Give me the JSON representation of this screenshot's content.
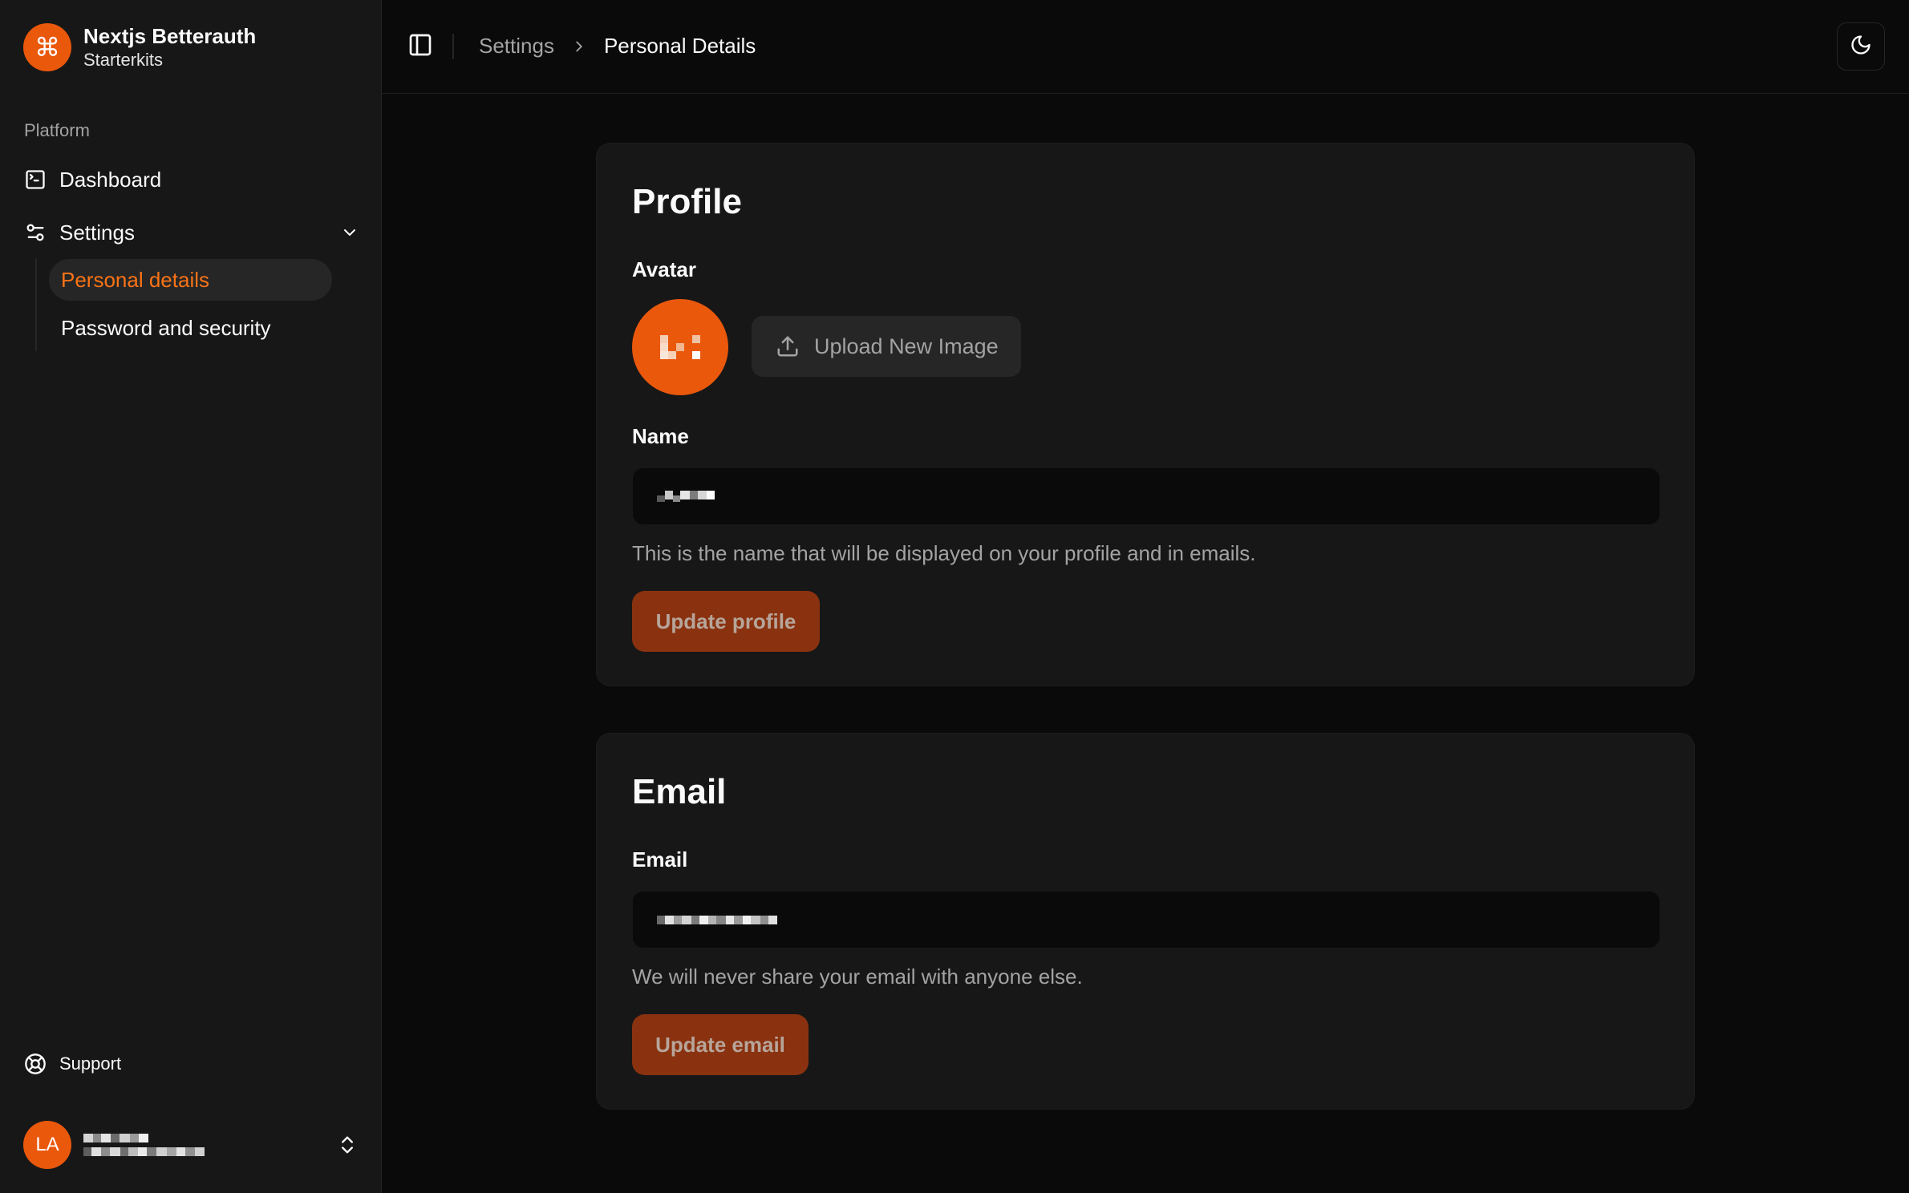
{
  "brand": {
    "name": "Nextjs Betterauth",
    "subtitle": "Starterkits",
    "logo_icon": "command-icon"
  },
  "sidebar": {
    "group_label": "Platform",
    "items": [
      {
        "label": "Dashboard",
        "icon": "terminal-square-icon"
      },
      {
        "label": "Settings",
        "icon": "settings-sliders-icon",
        "expanded": true
      }
    ],
    "sub_items": [
      {
        "label": "Personal details",
        "active": true
      },
      {
        "label": "Password and security",
        "active": false
      }
    ],
    "support_label": "Support",
    "user": {
      "initials": "LA"
    }
  },
  "header": {
    "breadcrumb_parent": "Settings",
    "breadcrumb_current": "Personal Details"
  },
  "profile": {
    "title": "Profile",
    "avatar_label": "Avatar",
    "upload_label": "Upload New Image",
    "name_label": "Name",
    "name_help": "This is the name that will be displayed on your profile and in emails.",
    "update_label": "Update profile"
  },
  "email": {
    "title": "Email",
    "email_label": "Email",
    "email_help": "We will never share your email with anyone else.",
    "update_label": "Update email"
  },
  "colors": {
    "accent": "#ea580c",
    "active_text": "#f97316",
    "background": "#0a0a0a",
    "card": "#171717"
  }
}
